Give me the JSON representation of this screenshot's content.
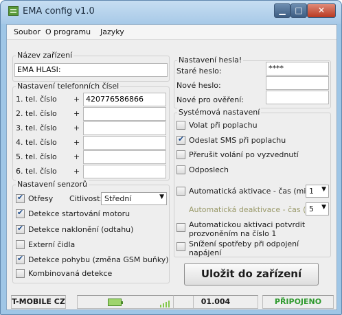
{
  "window": {
    "title": "EMA config v1.0",
    "minimize_glyph": "▁",
    "maximize_glyph": "□",
    "close_glyph": "✕"
  },
  "menu": {
    "items": [
      "Soubor",
      "O programu",
      "Jazyky"
    ]
  },
  "device": {
    "group_title": "Název zařízení",
    "name_value": "EMA HLASI:"
  },
  "phones": {
    "group_title": "Nastavení telefonních čísel",
    "plus": "+",
    "rows": [
      {
        "label": "1. tel. číslo",
        "value": "420776586866"
      },
      {
        "label": "2. tel. číslo",
        "value": ""
      },
      {
        "label": "3. tel. číslo",
        "value": ""
      },
      {
        "label": "4. tel. číslo",
        "value": ""
      },
      {
        "label": "5. tel. číslo",
        "value": ""
      },
      {
        "label": "6. tel. číslo",
        "value": ""
      }
    ]
  },
  "password": {
    "group_title": "Nastavení hesla!",
    "old_label": "Staré heslo:",
    "old_value": "****",
    "new_label": "Nové heslo:",
    "new_value": "",
    "confirm_label": "Nové pro ověření:",
    "confirm_value": ""
  },
  "sensors": {
    "group_title": "Nastavení senzorů",
    "shock_label": "Otřesy",
    "shock_checked": true,
    "sensitivity_label": "Citlivost:",
    "sensitivity_value": "Střední",
    "motor_label": "Detekce startování motoru",
    "motor_checked": true,
    "tilt_label": "Detekce naklonění (odtahu)",
    "tilt_checked": true,
    "external_label": "Externí čidla",
    "external_checked": false,
    "motion_label": "Detekce pohybu (změna GSM buňky)",
    "motion_checked": true,
    "combined_label": "Kombinovaná detekce",
    "combined_checked": false
  },
  "system": {
    "group_title": "Systémová nastavení",
    "call_label": "Volat při poplachu",
    "call_checked": false,
    "sms_label": "Odeslat SMS při poplachu",
    "sms_checked": true,
    "interrupt_label": "Přerušit volání po vyzvednutí",
    "interrupt_checked": false,
    "listen_label": "Odposlech",
    "listen_checked": false,
    "autoarm_label": "Automatická aktivace - čas (min)",
    "autoarm_checked": false,
    "autoarm_value": "1",
    "autodisarm_label": "Automatická deaktivace - čas (s)",
    "autodisarm_value": "5",
    "confirm_line1": "Automatickou aktivaci potvrdit",
    "confirm_line2": "prozvoněním na číslo 1",
    "confirm_checked": false,
    "power_line1": "Snížení spotřeby při odpojení",
    "power_line2": "napájení",
    "power_checked": false
  },
  "save_button": "Uložit do zařízení",
  "status": {
    "operator": "T-MOBILE CZ",
    "version": "01.004",
    "connection": "PŘIPOJENO",
    "colors": {
      "connection": "#2f9a2f",
      "signal": "#83c84a"
    }
  }
}
